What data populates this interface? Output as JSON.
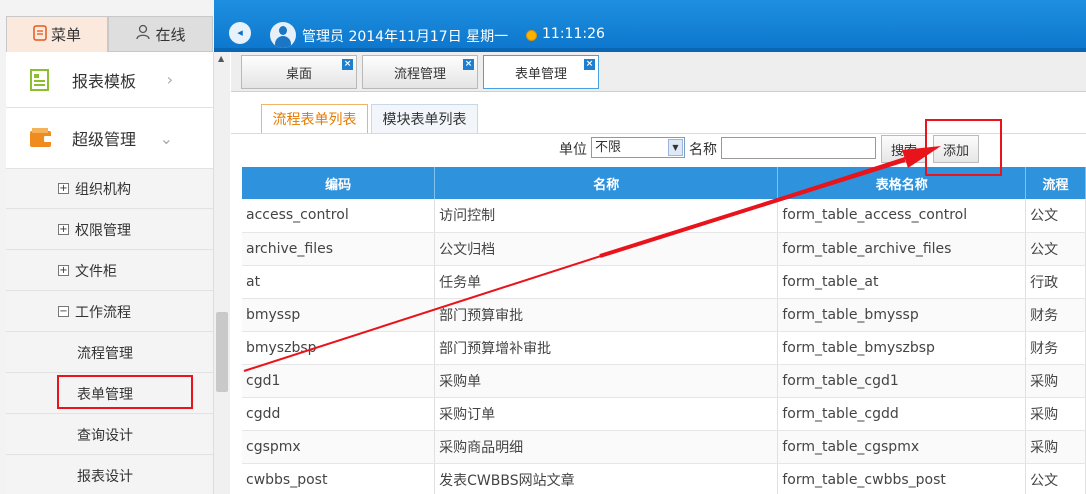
{
  "header": {
    "user_info": "管理员 2014年11月17日 星期一",
    "time": "11:11:26",
    "collapse_icon": "collapse-left-icon",
    "collapse_glyph": "◂"
  },
  "sidebar": {
    "tab_menu": "菜单",
    "tab_online": "在线",
    "blocks": [
      {
        "label": "报表模板",
        "arrow": "›"
      },
      {
        "label": "超级管理",
        "arrow": "⌄"
      }
    ],
    "tree": [
      {
        "label": "组织机构",
        "toggle": "+"
      },
      {
        "label": "权限管理",
        "toggle": "+"
      },
      {
        "label": "文件柜",
        "toggle": "+"
      },
      {
        "label": "工作流程",
        "toggle": "−"
      }
    ],
    "subitems": [
      "流程管理",
      "表单管理",
      "查询设计",
      "报表设计"
    ]
  },
  "page_tabs": [
    {
      "label": "桌面"
    },
    {
      "label": "流程管理"
    },
    {
      "label": "表单管理"
    }
  ],
  "sub_tabs": [
    "流程表单列表",
    "模块表单列表"
  ],
  "filter": {
    "unit_label": "单位",
    "unit_value": "不限",
    "name_label": "名称",
    "name_value": "",
    "search_button": "搜索",
    "add_button": "添加"
  },
  "table": {
    "columns": [
      "编码",
      "名称",
      "表格名称",
      "流程"
    ],
    "rows": [
      [
        "access_control",
        "访问控制",
        "form_table_access_control",
        "公文"
      ],
      [
        "archive_files",
        "公文归档",
        "form_table_archive_files",
        "公文"
      ],
      [
        "at",
        "任务单",
        "form_table_at",
        "行政"
      ],
      [
        "bmyssp",
        "部门预算审批",
        "form_table_bmyssp",
        "财务"
      ],
      [
        "bmyszbsp",
        "部门预算增补审批",
        "form_table_bmyszbsp",
        "财务"
      ],
      [
        "cgd1",
        "采购单",
        "form_table_cgd1",
        "采购"
      ],
      [
        "cgdd",
        "采购订单",
        "form_table_cgdd",
        "采购"
      ],
      [
        "cgspmx",
        "采购商品明细",
        "form_table_cgspmx",
        "采购"
      ],
      [
        "cwbbs_post",
        "发表CWBBS网站文章",
        "form_table_cwbbs_post",
        "公文"
      ]
    ]
  },
  "colors": {
    "header_blue": "#1e8fe0",
    "table_header": "#2f92dc",
    "annotation_red": "#e8131b",
    "active_subtab": "#e47b00"
  }
}
